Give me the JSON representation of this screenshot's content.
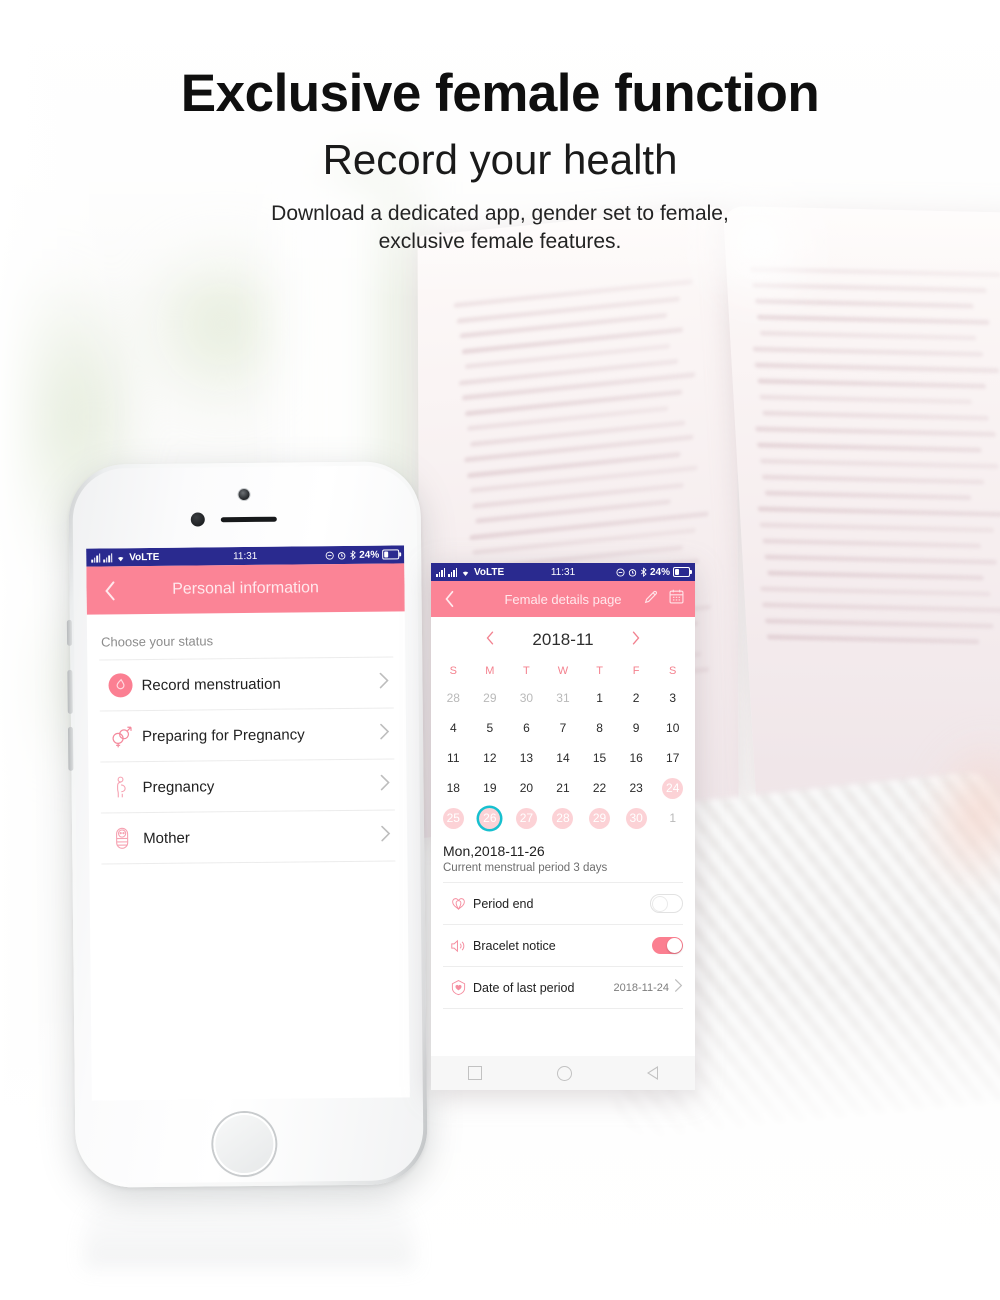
{
  "hero": {
    "title": "Exclusive female function",
    "subtitle": "Record your health",
    "description_line1": "Download a dedicated app, gender set to female,",
    "description_line2": "exclusive female features."
  },
  "colors": {
    "brand_pink": "#FB8496",
    "status_bar_blue": "#2A2A8F",
    "marked_day_pink": "#FCD2D6",
    "today_ring_teal": "#17C0CF",
    "toggle_on_pink": "#FB7F90"
  },
  "status_bar": {
    "carrier": "VoLTE",
    "time": "11:31",
    "battery_percent": "24%",
    "icons": [
      "signal-bars-icon",
      "signal-bars-icon",
      "wifi-icon",
      "mute-icon",
      "alarm-icon",
      "bluetooth-icon",
      "battery-icon"
    ]
  },
  "phone_left": {
    "appbar": {
      "back_icon": "chevron-left-icon",
      "title": "Personal information"
    },
    "section_label": "Choose your status",
    "rows": [
      {
        "label": "Record menstruation",
        "icon": "menstruation-drop-icon",
        "selected": true
      },
      {
        "label": "Preparing for Pregnancy",
        "icon": "gender-symbols-icon",
        "selected": false
      },
      {
        "label": "Pregnancy",
        "icon": "pregnant-woman-icon",
        "selected": false
      },
      {
        "label": "Mother",
        "icon": "swaddled-baby-icon",
        "selected": false
      }
    ]
  },
  "phone_right": {
    "appbar": {
      "back_icon": "chevron-left-icon",
      "title": "Female details page",
      "actions": [
        "pencil-edit-icon",
        "calendar-icon"
      ]
    },
    "calendar": {
      "prev_icon": "chevron-left-icon",
      "next_icon": "chevron-right-icon",
      "month_label": "2018-11",
      "weekdays": [
        "S",
        "M",
        "T",
        "W",
        "T",
        "F",
        "S"
      ],
      "weeks": [
        [
          {
            "d": "28",
            "state": "muted"
          },
          {
            "d": "29",
            "state": "muted"
          },
          {
            "d": "30",
            "state": "muted"
          },
          {
            "d": "31",
            "state": "muted"
          },
          {
            "d": "1",
            "state": "normal"
          },
          {
            "d": "2",
            "state": "normal"
          },
          {
            "d": "3",
            "state": "normal"
          }
        ],
        [
          {
            "d": "4",
            "state": "normal"
          },
          {
            "d": "5",
            "state": "normal"
          },
          {
            "d": "6",
            "state": "normal"
          },
          {
            "d": "7",
            "state": "normal"
          },
          {
            "d": "8",
            "state": "normal"
          },
          {
            "d": "9",
            "state": "normal"
          },
          {
            "d": "10",
            "state": "normal"
          }
        ],
        [
          {
            "d": "11",
            "state": "normal"
          },
          {
            "d": "12",
            "state": "normal"
          },
          {
            "d": "13",
            "state": "normal"
          },
          {
            "d": "14",
            "state": "normal"
          },
          {
            "d": "15",
            "state": "normal"
          },
          {
            "d": "16",
            "state": "normal"
          },
          {
            "d": "17",
            "state": "normal"
          }
        ],
        [
          {
            "d": "18",
            "state": "normal"
          },
          {
            "d": "19",
            "state": "normal"
          },
          {
            "d": "20",
            "state": "normal"
          },
          {
            "d": "21",
            "state": "normal"
          },
          {
            "d": "22",
            "state": "normal"
          },
          {
            "d": "23",
            "state": "normal"
          },
          {
            "d": "24",
            "state": "marked"
          }
        ],
        [
          {
            "d": "25",
            "state": "marked"
          },
          {
            "d": "26",
            "state": "today"
          },
          {
            "d": "27",
            "state": "marked"
          },
          {
            "d": "28",
            "state": "marked"
          },
          {
            "d": "29",
            "state": "marked"
          },
          {
            "d": "30",
            "state": "marked"
          },
          {
            "d": "1",
            "state": "muted"
          }
        ]
      ]
    },
    "selected_date": "Mon,2018-11-26",
    "selected_subtitle": "Current menstrual period 3 days",
    "options": [
      {
        "label": "Period end",
        "icon": "double-heart-icon",
        "control": "toggle",
        "on": false
      },
      {
        "label": "Bracelet notice",
        "icon": "speaker-icon",
        "control": "toggle",
        "on": true
      },
      {
        "label": "Date of last period",
        "icon": "heart-shield-icon",
        "control": "value",
        "value": "2018-11-24",
        "chevron": "chevron-right-icon"
      }
    ],
    "navbar": [
      "recents-square-icon",
      "home-circle-icon",
      "back-triangle-icon"
    ]
  }
}
